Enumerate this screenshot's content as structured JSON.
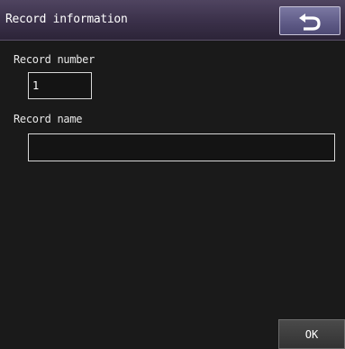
{
  "header": {
    "title": "Record information",
    "back_icon": "undo-arrow-icon"
  },
  "form": {
    "record_number": {
      "label": "Record number",
      "value": "1"
    },
    "record_name": {
      "label": "Record name",
      "value": ""
    }
  },
  "footer": {
    "ok_label": "OK"
  },
  "colors": {
    "title_bar": "#3a3049",
    "back_button": "#5e5a86",
    "background": "#1a1a1a",
    "text": "#ffffff"
  }
}
